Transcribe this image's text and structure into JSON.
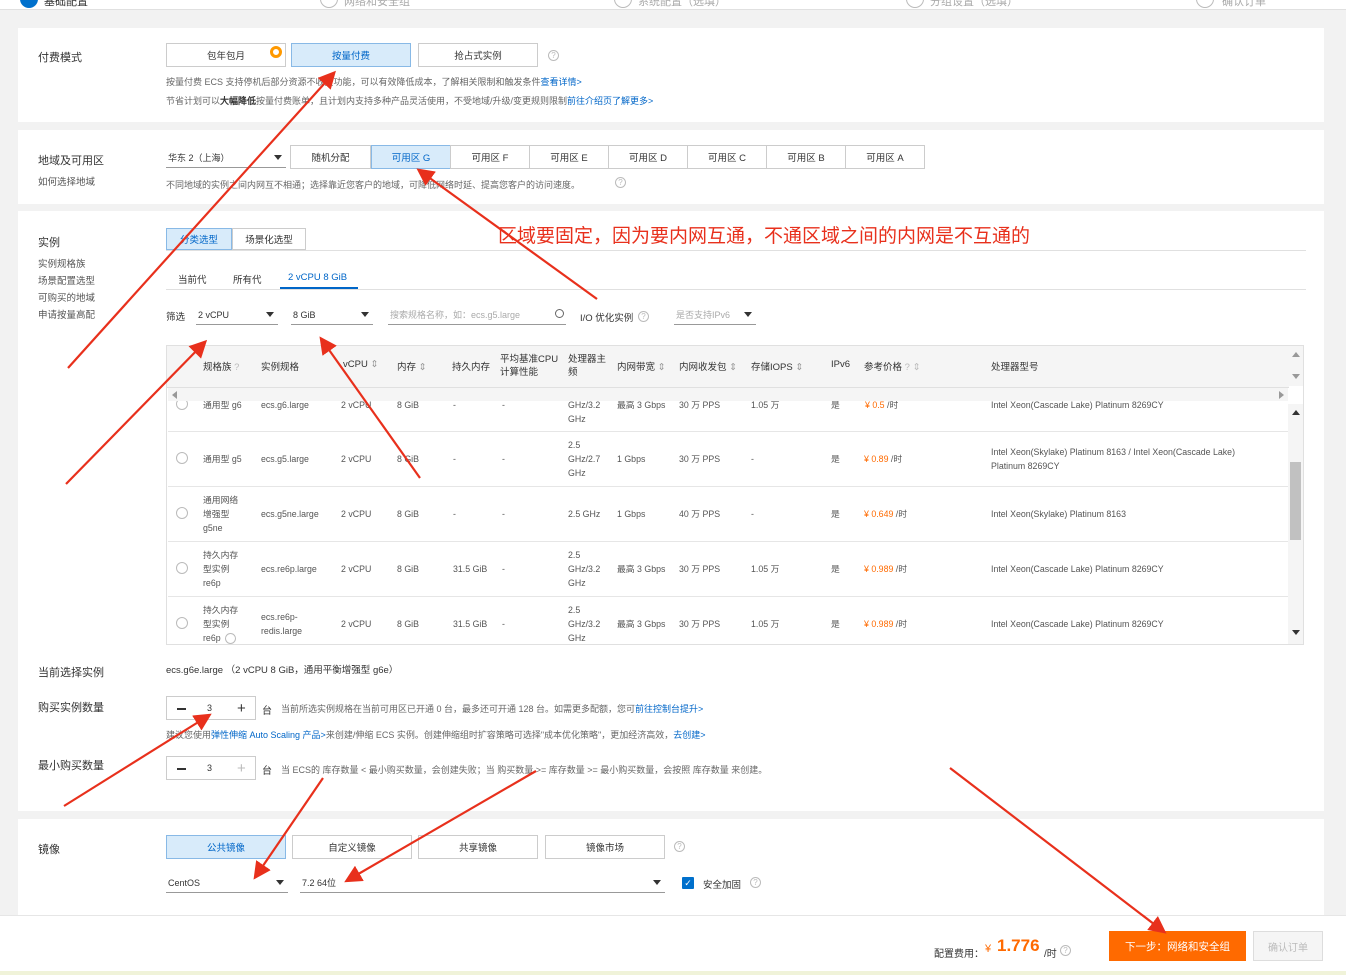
{
  "steps": [
    "基础配置",
    "网络和安全组",
    "系统配置（选填）",
    "分组设置（选填）",
    "确认订单"
  ],
  "billing": {
    "label": "付费模式",
    "options": [
      "包年包月",
      "按量付费",
      "抢占式实例"
    ],
    "note1": "按量付费 ECS 支持停机后部分资源不收费功能，可以有效降低成本，了解相关限制和触发条件",
    "note1_link": "查看详情>",
    "note2_a": "节省计划可以",
    "note2_b": "大幅降低",
    "note2_c": "按量付费账单，且计划内支持多种产品灵活使用，不受地域/升级/变更规则限制",
    "note2_link": "前往介绍页了解更多>"
  },
  "region": {
    "label": "地域及可用区",
    "sub": "如何选择地域",
    "selected": "华东 2（上海）",
    "zones": [
      "随机分配",
      "可用区 G",
      "可用区 F",
      "可用区 E",
      "可用区 D",
      "可用区 C",
      "可用区 B",
      "可用区 A"
    ],
    "note": "不同地域的实例之间内网互不相通；选择靠近您客户的地域，可降低网络时延、提高您客户的访问速度。"
  },
  "annotation": "区域要固定，因为要内网互通，不通区域之间的内网是不互通的",
  "instance": {
    "label": "实例",
    "side_links": [
      "实例规格族",
      "场景配置选型",
      "可购买的地域",
      "申请按量高配"
    ],
    "tabs": [
      "分类选型",
      "场景化选型"
    ],
    "gen_tabs": [
      "当前代",
      "所有代",
      "2 vCPU 8 GiB"
    ],
    "filter_label": "筛选",
    "cpu_filter": "2 vCPU",
    "mem_filter": "8 GiB",
    "search_placeholder": "搜索规格名称，如：ecs.g5.large",
    "io_label": "I/O 优化实例",
    "ipv6_filter": "是否支持IPv6",
    "columns": [
      "规格族",
      "实例规格",
      "vCPU",
      "内存",
      "持久内存",
      "平均基准CPU",
      "计算性能",
      "处理器主",
      "频",
      "内网带宽",
      "内网收发包",
      "存储IOPS",
      "IPv6",
      "参考价格",
      "处理器型号"
    ],
    "partial_row": {
      "family": "通用型 g6",
      "spec": "ecs.g6.large",
      "cpu": "2 vCPU",
      "mem": "8 GiB",
      "pmem": "-",
      "base": "-",
      "freq": "GHz/3.2",
      "bw": "最高 3 Gbps",
      "pps": "30 万 PPS",
      "iops": "1.05 万",
      "ipv6": "是",
      "price": "¥ 0.5",
      "unit": "/时",
      "model": "Intel Xeon(Cascade Lake) Platinum 8269CY"
    },
    "rows": [
      {
        "family": [
          "通用型 g5"
        ],
        "spec": [
          "ecs.g5.large"
        ],
        "cpu": "2 vCPU",
        "mem": "8 GiB",
        "pmem": "-",
        "base": "-",
        "freq": [
          "2.5",
          "GHz/2.7",
          "GHz"
        ],
        "bw": "1 Gbps",
        "pps": "30 万 PPS",
        "iops": "-",
        "ipv6": "是",
        "price": "¥ 0.89",
        "unit": "/时",
        "model": [
          "Intel Xeon(Skylake) Platinum 8163 / Intel Xeon(Cascade Lake)",
          "Platinum 8269CY"
        ]
      },
      {
        "family": [
          "通用网络",
          "增强型",
          "g5ne"
        ],
        "spec": [
          "ecs.g5ne.large"
        ],
        "cpu": "2 vCPU",
        "mem": "8 GiB",
        "pmem": "-",
        "base": "-",
        "freq": [
          "2.5 GHz"
        ],
        "bw": "1 Gbps",
        "pps": "40 万 PPS",
        "iops": "-",
        "ipv6": "是",
        "price": "¥ 0.649",
        "unit": "/时",
        "model": [
          "Intel Xeon(Skylake) Platinum 8163"
        ]
      },
      {
        "family": [
          "持久内存",
          "型实例",
          "re6p"
        ],
        "spec": [
          "ecs.re6p.large"
        ],
        "cpu": "2 vCPU",
        "mem": "8 GiB",
        "pmem": "31.5 GiB",
        "base": "-",
        "freq": [
          "2.5",
          "GHz/3.2",
          "GHz"
        ],
        "bw": "最高 3 Gbps",
        "pps": "30 万 PPS",
        "iops": "1.05 万",
        "ipv6": "是",
        "price": "¥ 0.989",
        "unit": "/时",
        "model": [
          "Intel Xeon(Cascade Lake) Platinum 8269CY"
        ]
      },
      {
        "family": [
          "持久内存",
          "型实例",
          "re6p"
        ],
        "spec": [
          "ecs.re6p-",
          "redis.large"
        ],
        "cpu": "2 vCPU",
        "mem": "8 GiB",
        "pmem": "31.5 GiB",
        "base": "-",
        "freq": [
          "2.5",
          "GHz/3.2",
          "GHz"
        ],
        "bw": "最高 3 Gbps",
        "pps": "30 万 PPS",
        "iops": "1.05 万",
        "ipv6": "是",
        "price": "¥ 0.989",
        "unit": "/时",
        "model": [
          "Intel Xeon(Cascade Lake) Platinum 8269CY"
        ]
      }
    ],
    "current_label": "当前选择实例",
    "current_value": "ecs.g6e.large （2 vCPU 8 GiB，通用平衡增强型 g6e）",
    "qty_label": "购买实例数量",
    "qty_value": "3",
    "qty_unit": "台",
    "qty_note_a": "当前所选实例规格在当前可用区已开通 0 台，最多还可开通 128 台。如需更多配额，您可",
    "qty_note_link": "前往控制台提升>",
    "scaling_a": "建议您使用",
    "scaling_link": "弹性伸缩 Auto Scaling 产品>",
    "scaling_b": "来创建/伸缩 ECS 实例。创建伸缩组时扩容策略可选择\"成本优化策略\"，更加经济高效，",
    "scaling_link2": "去创建>",
    "min_label": "最小购买数量",
    "min_value": "3",
    "min_unit": "台",
    "min_note": "当 ECS的 库存数量 < 最小购买数量，会创建失败；当 购买数量 >= 库存数量 >= 最小购买数量，会按照 库存数量 来创建。"
  },
  "image": {
    "label": "镜像",
    "tabs": [
      "公共镜像",
      "自定义镜像",
      "共享镜像",
      "镜像市场"
    ],
    "os": "CentOS",
    "version": "7.2 64位",
    "hardening": "安全加固"
  },
  "footer": {
    "cost_label": "配置费用：",
    "currency": "¥",
    "cost_value": "1.776",
    "cost_unit": "/时",
    "next_button": "下一步：网络和安全组",
    "confirm_button": "确认订单"
  },
  "colors": {
    "accent": "#ff6a00",
    "link": "#0066c8",
    "active_bg": "#d8ebfa",
    "arrow": "#e8301c"
  }
}
